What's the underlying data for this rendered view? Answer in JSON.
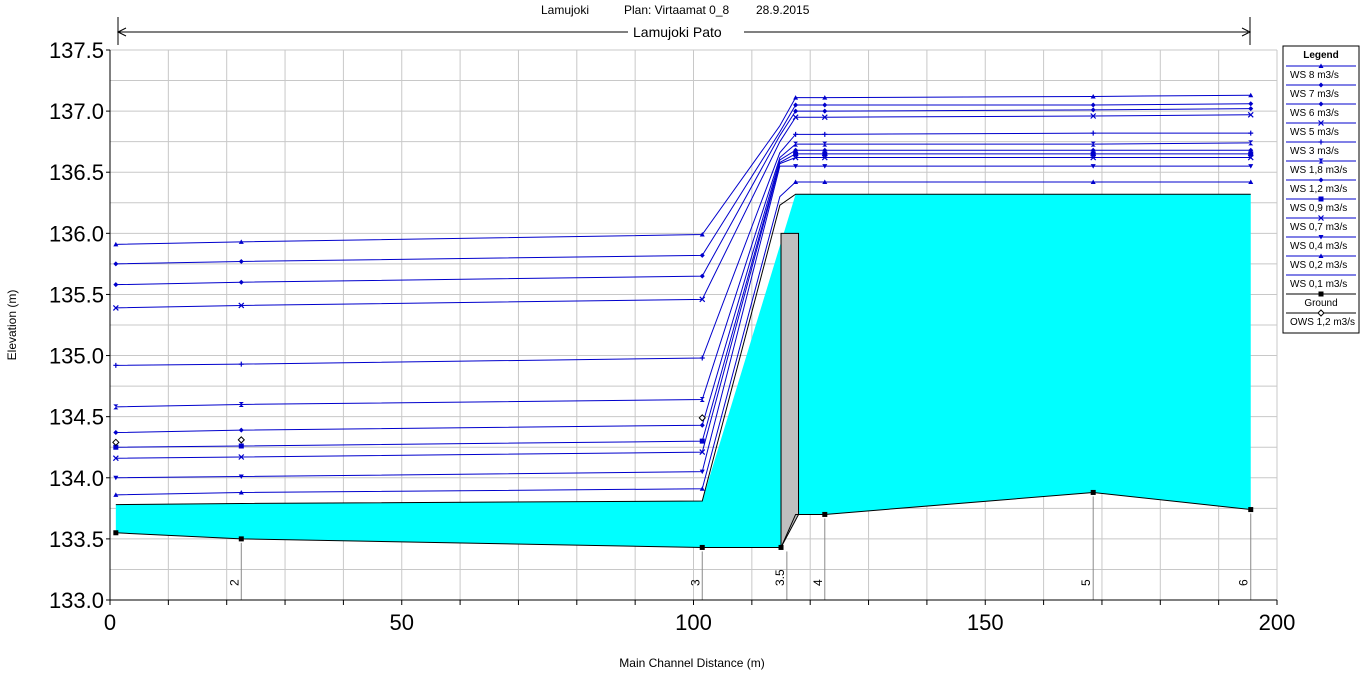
{
  "chart_data": {
    "type": "line",
    "title": {
      "project": "Lamujoki",
      "plan": "Plan: Virtaamat 0_8",
      "date": "28.9.2015",
      "reach": "Lamujoki Pato"
    },
    "xlabel": "Main Channel Distance (m)",
    "ylabel": "Elevation (m)",
    "xlim": [
      0,
      200
    ],
    "ylim": [
      133.0,
      137.5
    ],
    "x_ticks": [
      0,
      50,
      100,
      150,
      200
    ],
    "y_ticks": [
      "133.0",
      "133.5",
      "134.0",
      "134.5",
      "135.0",
      "135.5",
      "136.0",
      "136.5",
      "137.0",
      "137.5"
    ],
    "grid": true,
    "legend_position": "right",
    "legend_title": "Legend",
    "stations": [
      {
        "label": "2",
        "x": 22.5
      },
      {
        "label": "3",
        "x": 101.5
      },
      {
        "label": "3.5",
        "x": 116.0
      },
      {
        "label": "4",
        "x": 122.5
      },
      {
        "label": "5",
        "x": 168.5
      },
      {
        "label": "6",
        "x": 195.5
      }
    ],
    "ground": {
      "name": "Ground",
      "x": [
        1.0,
        22.5,
        101.5,
        115.0,
        117.5,
        122.5,
        168.5,
        195.5
      ],
      "y": [
        133.55,
        133.5,
        133.43,
        133.43,
        133.7,
        133.7,
        133.88,
        133.74
      ]
    },
    "weir": {
      "x0": 115.0,
      "x1": 118.0,
      "top": 136.0
    },
    "water_fill": {
      "x": [
        1.0,
        101.5,
        117.5,
        195.5
      ],
      "y": [
        133.78,
        133.81,
        136.32,
        136.32
      ]
    },
    "ws_x": [
      1.0,
      22.5,
      101.5,
      114.8,
      117.5,
      122.5,
      168.5,
      195.5
    ],
    "series": [
      {
        "name": "WS  8 m3/s",
        "marker": "tri-up",
        "values": [
          135.91,
          135.93,
          135.99,
          136.88,
          137.11,
          137.11,
          137.12,
          137.13
        ]
      },
      {
        "name": "WS  7 m3/s",
        "marker": "diamond",
        "values": [
          135.75,
          135.77,
          135.82,
          136.83,
          137.05,
          137.05,
          137.05,
          137.06
        ]
      },
      {
        "name": "WS  6 m3/s",
        "marker": "diamond",
        "values": [
          135.58,
          135.6,
          135.65,
          136.8,
          137.0,
          137.0,
          137.01,
          137.02
        ]
      },
      {
        "name": "WS  5 m3/s",
        "marker": "x",
        "values": [
          135.39,
          135.41,
          135.46,
          136.75,
          136.95,
          136.95,
          136.96,
          136.97
        ]
      },
      {
        "name": "WS  3 m3/s",
        "marker": "plus",
        "values": [
          134.92,
          134.93,
          134.98,
          136.66,
          136.81,
          136.81,
          136.82,
          136.82
        ]
      },
      {
        "name": "WS  1,8 m3/s",
        "marker": "hourglass",
        "values": [
          134.58,
          134.6,
          134.64,
          136.62,
          136.73,
          136.73,
          136.73,
          136.74
        ]
      },
      {
        "name": "WS  1,2 m3/s",
        "marker": "diamond",
        "values": [
          134.37,
          134.39,
          134.43,
          136.6,
          136.68,
          136.68,
          136.68,
          136.68
        ]
      },
      {
        "name": "WS  0,9 m3/s",
        "marker": "square",
        "values": [
          134.25,
          134.26,
          134.3,
          136.58,
          136.65,
          136.65,
          136.65,
          136.65
        ]
      },
      {
        "name": "WS  0,7 m3/s",
        "marker": "x",
        "values": [
          134.16,
          134.17,
          134.21,
          136.57,
          136.62,
          136.62,
          136.62,
          136.62
        ]
      },
      {
        "name": "WS  0,4 m3/s",
        "marker": "tri-down",
        "values": [
          134.0,
          134.01,
          134.05,
          136.55,
          136.55,
          136.55,
          136.55,
          136.55
        ]
      },
      {
        "name": "WS  0,2 m3/s",
        "marker": "tri-up",
        "values": [
          133.86,
          133.88,
          133.91,
          136.3,
          136.42,
          136.42,
          136.42,
          136.42
        ]
      },
      {
        "name": "WS  0,1 m3/s",
        "marker": "none",
        "values": [
          133.78,
          133.79,
          133.81,
          136.23,
          136.32,
          136.32,
          136.32,
          136.32
        ]
      }
    ],
    "ows": {
      "name": "OWS  1,2 m3/s",
      "marker": "diamond-open",
      "x": [
        1.0,
        22.5,
        101.5
      ],
      "y": [
        134.29,
        134.31,
        134.49
      ]
    },
    "colors": {
      "ws": "#0000cc",
      "ground": "#000000",
      "water": "#00ffff",
      "weir": "#bfbfbf",
      "grid": "#c8c8c8"
    }
  }
}
